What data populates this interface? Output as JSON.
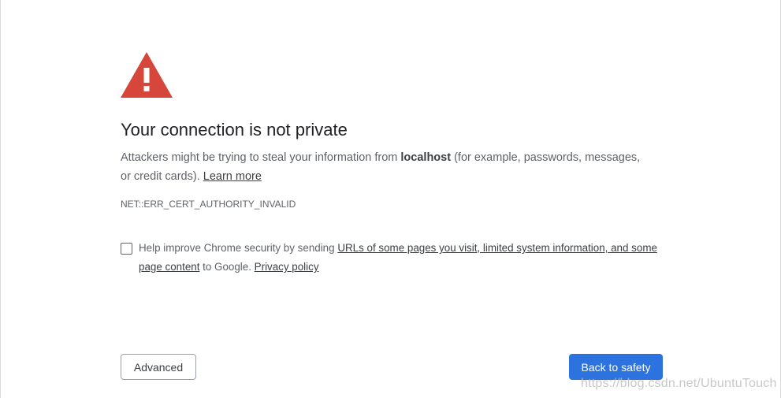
{
  "colors": {
    "warning_icon": "#d6463a",
    "primary_button": "#2c73df",
    "body_text": "#5f6368",
    "heading_text": "#202124"
  },
  "icons": {
    "warning": "warning-triangle-icon"
  },
  "heading": "Your connection is not private",
  "explanation": {
    "before_host": "Attackers might be trying to steal your information from ",
    "host": "localhost",
    "after_host": " (for example, passwords, messages, or credit cards). ",
    "learn_more": "Learn more"
  },
  "error_code": "NET::ERR_CERT_AUTHORITY_INVALID",
  "opt_in": {
    "checked": false,
    "before_link": "Help improve Chrome security by sending ",
    "link": "URLs of some pages you visit, limited system information, and some page content",
    "middle": " to Google. ",
    "privacy_link": "Privacy policy"
  },
  "buttons": {
    "advanced": "Advanced",
    "back_to_safety": "Back to safety"
  },
  "watermark": "https://blog.csdn.net/UbuntuTouch"
}
